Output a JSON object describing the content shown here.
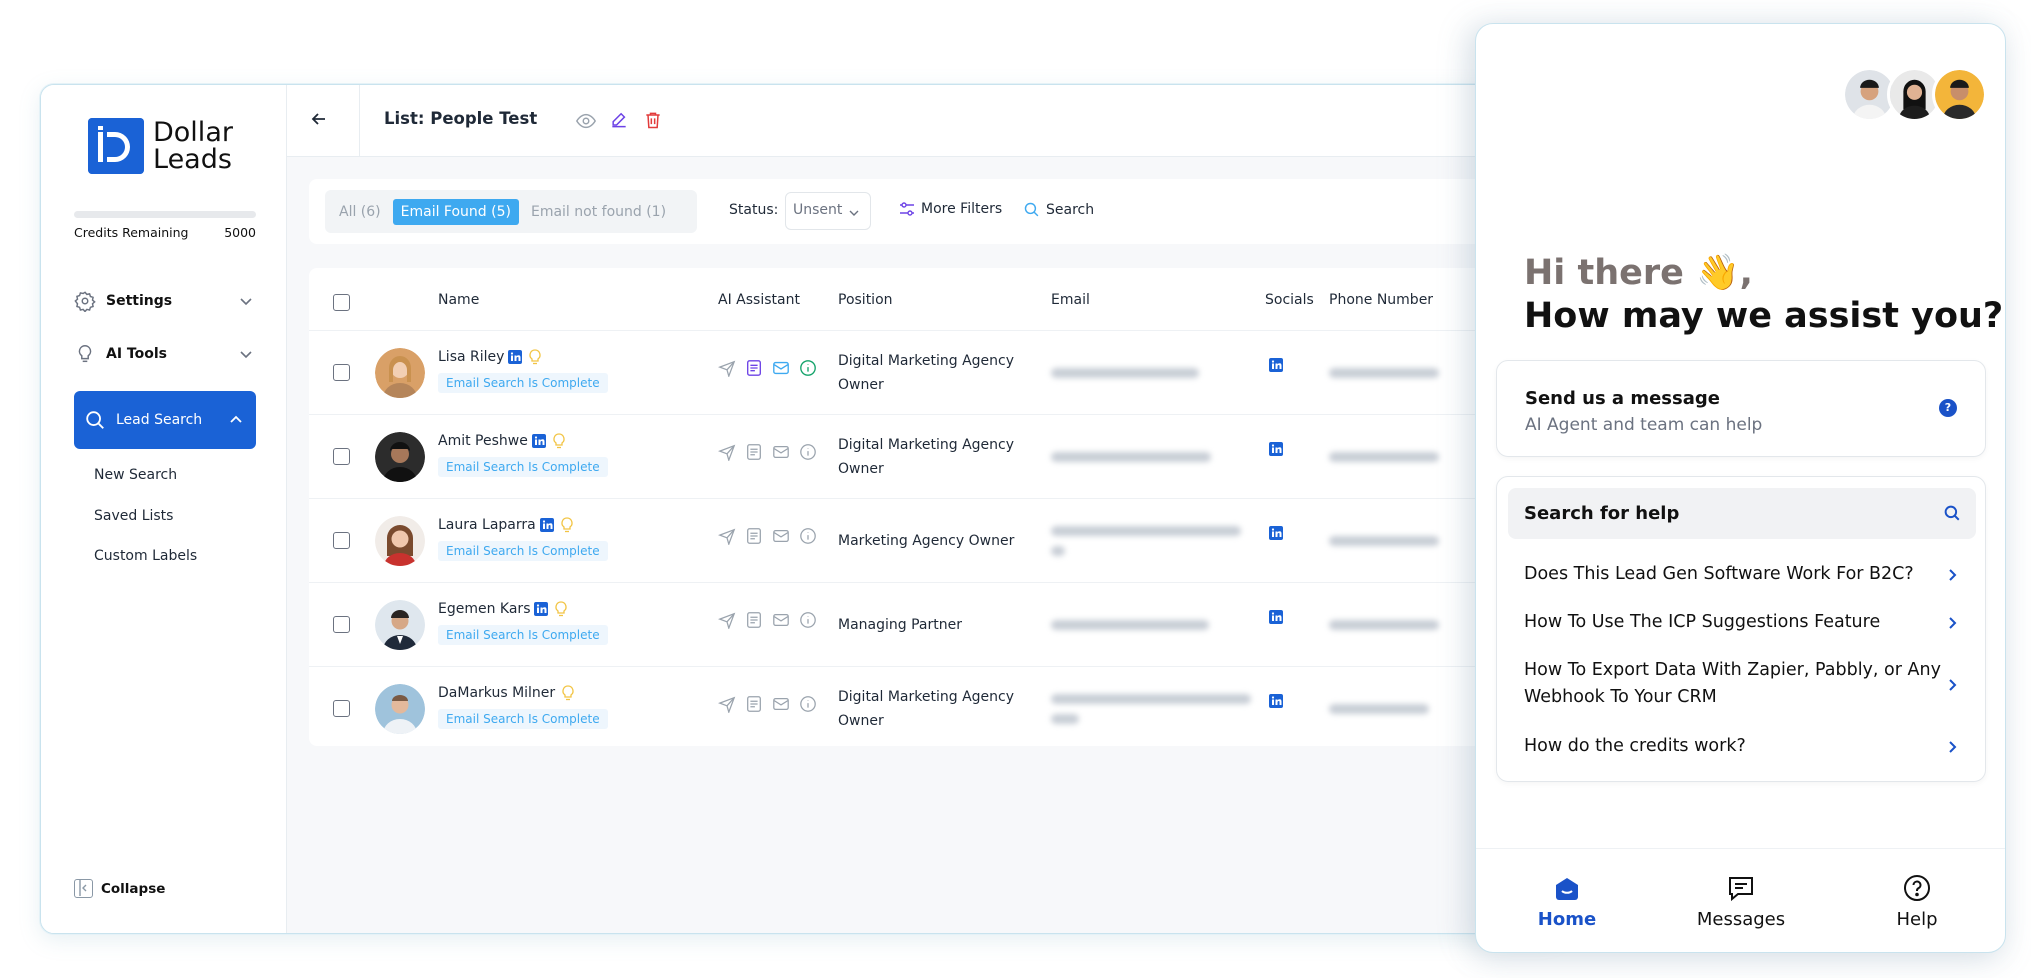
{
  "brand": {
    "name_line1": "Dollar",
    "name_line2": "Leads",
    "logo_color": "#1a62d6"
  },
  "credits": {
    "label": "Credits Remaining",
    "value": "5000"
  },
  "sidebar": {
    "settings_label": "Settings",
    "ai_tools_label": "AI Tools",
    "lead_search_label": "Lead Search",
    "sub_items": [
      "New Search",
      "Saved Lists",
      "Custom Labels"
    ],
    "collapse_label": "Collapse"
  },
  "header": {
    "title": "List: People Test"
  },
  "filters": {
    "tabs": [
      "All (6)",
      "Email Found (5)",
      "Email not found (1)"
    ],
    "active_tab": 1,
    "status_label": "Status:",
    "status_value": "Unsent",
    "more_filters_label": "More Filters",
    "search_label": "Search"
  },
  "table": {
    "columns": [
      "Name",
      "AI Assistant",
      "Position",
      "Email",
      "Socials",
      "Phone Number"
    ],
    "badge_text": "Email Search Is Complete",
    "rows": [
      {
        "name": "Lisa Riley",
        "linkedin_badge": true,
        "position_line1": "Digital Marketing Agency",
        "position_line2": "Owner",
        "ai_active": true
      },
      {
        "name": "Amit Peshwe",
        "linkedin_badge": true,
        "position_line1": "Digital Marketing Agency",
        "position_line2": "Owner",
        "ai_active": false
      },
      {
        "name": "Laura Laparra",
        "linkedin_badge": true,
        "position_line1": "Marketing Agency Owner",
        "position_line2": "",
        "ai_active": false
      },
      {
        "name": "Egemen Kars",
        "linkedin_badge": true,
        "position_line1": "Managing Partner",
        "position_line2": "",
        "ai_active": false
      },
      {
        "name": "DaMarkus Milner",
        "linkedin_badge": false,
        "position_line1": "Digital Marketing Agency",
        "position_line2": "Owner",
        "ai_active": false
      }
    ]
  },
  "widget": {
    "greeting": "Hi there 👋,",
    "subgreeting": "How may we assist you?",
    "message_card": {
      "title": "Send us a message",
      "subtitle": "AI Agent and team can help"
    },
    "search_help": "Search for help",
    "faqs": [
      "Does This Lead Gen Software Work For B2C?",
      "How To Use The ICP Suggestions Feature",
      "How To Export Data With Zapier, Pabbly, or Any Webhook To Your CRM",
      "How do the credits work?"
    ],
    "nav": [
      "Home",
      "Messages",
      "Help"
    ],
    "accent": "#1a52c8"
  }
}
